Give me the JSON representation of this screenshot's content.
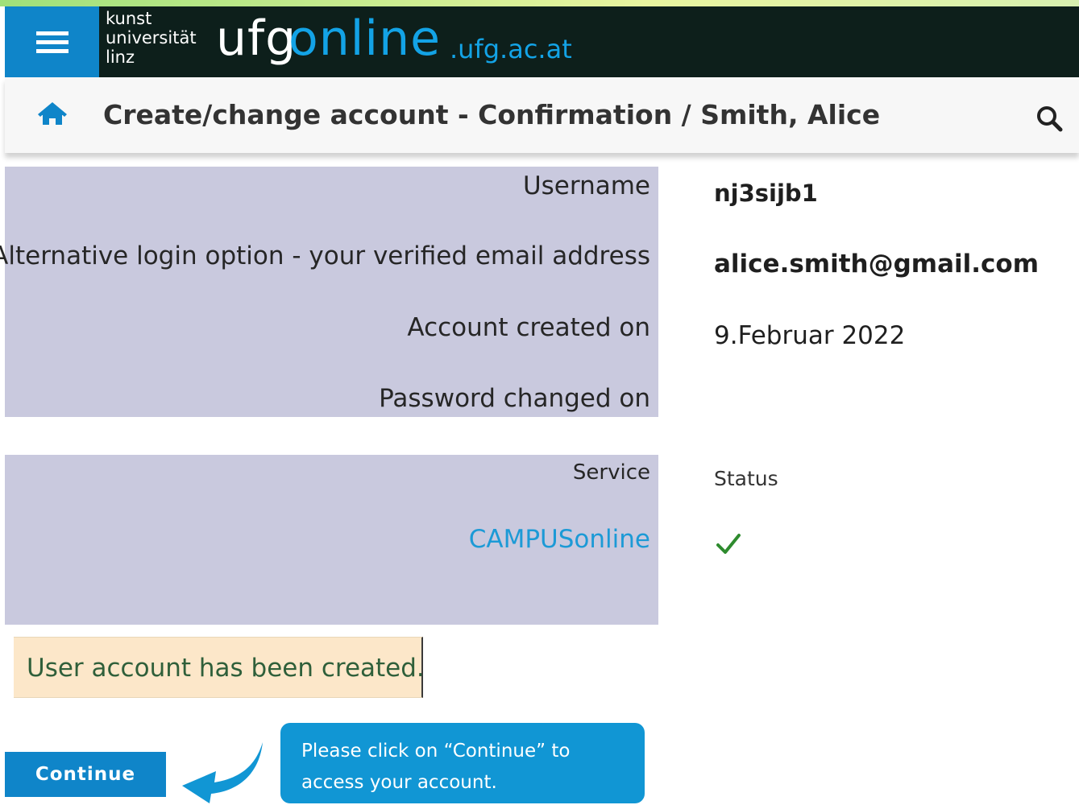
{
  "app": {
    "logo_line1": "kunst",
    "logo_line2": "universität",
    "logo_line3": "linz",
    "logo_main": "ufg",
    "logo_online": "online",
    "logo_domain": ".ufg.ac.at",
    "menu_icon": "hamburger-icon"
  },
  "header": {
    "title": "Create/change account - Confirmation  / Smith, Alice",
    "home_icon": "home-icon",
    "search_icon": "search-icon"
  },
  "account": {
    "username_label": "Username",
    "username_value": "nj3sijb1",
    "alt_login_label": "Alternative login option - your verified email address",
    "alt_login_value": "alice.smith@gmail.com",
    "created_label": "Account created on",
    "created_value": "9.Februar 2022",
    "password_label": "Password changed on",
    "password_value": ""
  },
  "services": {
    "service_header": "Service",
    "status_header": "Status",
    "rows": [
      {
        "service": "CAMPUSonline",
        "status_icon": "checkmark-icon"
      }
    ]
  },
  "notice": {
    "text": "User account has been created."
  },
  "actions": {
    "continue_label": "Continue"
  },
  "callout": {
    "text": "Please click on “Continue” to access your account."
  },
  "colors": {
    "brand_blue": "#0f85c9",
    "topbar_dark": "#0d1f1b",
    "panel_bg": "#c9c9de",
    "notice_bg": "#fce7c9",
    "success_green": "#2e8b2e"
  }
}
